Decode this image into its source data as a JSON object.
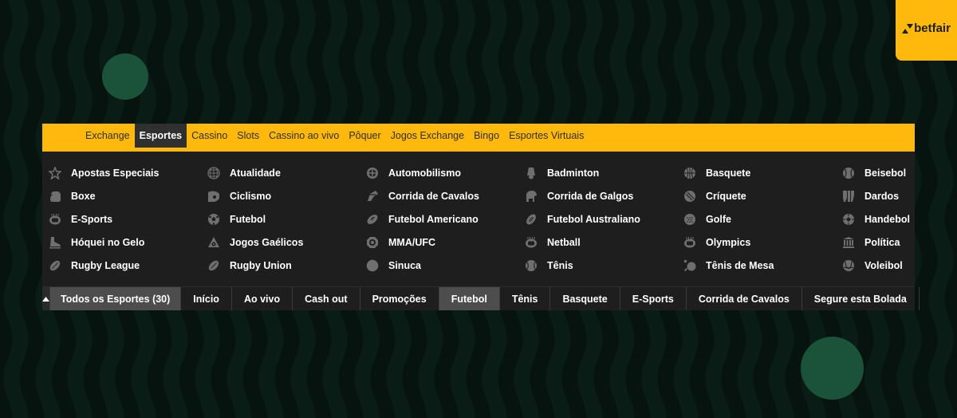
{
  "brand": {
    "name": "betfair",
    "accent_color": "#ffb80c"
  },
  "top_nav": {
    "items": [
      {
        "label": "Exchange",
        "active": false
      },
      {
        "label": "Esportes",
        "active": true
      },
      {
        "label": "Cassino",
        "active": false
      },
      {
        "label": "Slots",
        "active": false
      },
      {
        "label": "Cassino ao vivo",
        "active": false
      },
      {
        "label": "Pôquer",
        "active": false
      },
      {
        "label": "Jogos Exchange",
        "active": false
      },
      {
        "label": "Bingo",
        "active": false
      },
      {
        "label": "Esportes Virtuais",
        "active": false
      }
    ]
  },
  "sports": [
    {
      "label": "Apostas Especiais",
      "icon": "star-icon"
    },
    {
      "label": "Atualidade",
      "icon": "globe-icon"
    },
    {
      "label": "Automobilismo",
      "icon": "steering-wheel-icon"
    },
    {
      "label": "Badminton",
      "icon": "shuttlecock-icon"
    },
    {
      "label": "Basquete",
      "icon": "basketball-icon"
    },
    {
      "label": "Beisebol",
      "icon": "baseball-icon"
    },
    {
      "label": "Boxe",
      "icon": "boxing-glove-icon"
    },
    {
      "label": "Ciclismo",
      "icon": "cycling-helmet-icon"
    },
    {
      "label": "Corrida de Cavalos",
      "icon": "horse-racing-icon"
    },
    {
      "label": "Corrida de Galgos",
      "icon": "greyhound-icon"
    },
    {
      "label": "Críquete",
      "icon": "cricket-ball-icon"
    },
    {
      "label": "Dardos",
      "icon": "darts-icon"
    },
    {
      "label": "E-Sports",
      "icon": "stadium-icon"
    },
    {
      "label": "Futebol",
      "icon": "soccer-ball-icon"
    },
    {
      "label": "Futebol Americano",
      "icon": "american-football-icon"
    },
    {
      "label": "Futebol Australiano",
      "icon": "aussie-football-icon"
    },
    {
      "label": "Golfe",
      "icon": "golf-ball-icon"
    },
    {
      "label": "Handebol",
      "icon": "handball-icon"
    },
    {
      "label": "Hóquei no Gelo",
      "icon": "ice-skate-icon"
    },
    {
      "label": "Jogos Gaélicos",
      "icon": "gaelic-icon"
    },
    {
      "label": "MMA/UFC",
      "icon": "octagon-icon"
    },
    {
      "label": "Netball",
      "icon": "stadium-icon"
    },
    {
      "label": "Olympics",
      "icon": "stadium-icon"
    },
    {
      "label": "Política",
      "icon": "government-building-icon"
    },
    {
      "label": "Rugby League",
      "icon": "rugby-ball-icon"
    },
    {
      "label": "Rugby Union",
      "icon": "rugby-ball-icon"
    },
    {
      "label": "Sinuca",
      "icon": "snooker-ball-icon"
    },
    {
      "label": "Tênis",
      "icon": "tennis-ball-icon"
    },
    {
      "label": "Tênis de Mesa",
      "icon": "table-tennis-icon"
    },
    {
      "label": "Voleibol",
      "icon": "volleyball-icon"
    }
  ],
  "bottom_nav": {
    "toggle_icon": "chevron-up-icon",
    "items": [
      {
        "label": "Todos os Esportes (30)",
        "active": true
      },
      {
        "label": "Início",
        "active": false
      },
      {
        "label": "Ao vivo",
        "active": false
      },
      {
        "label": "Cash out",
        "active": false
      },
      {
        "label": "Promoções",
        "active": false
      },
      {
        "label": "Futebol",
        "active": true
      },
      {
        "label": "Tênis",
        "active": false
      },
      {
        "label": "Basquete",
        "active": false
      },
      {
        "label": "E-Sports",
        "active": false
      },
      {
        "label": "Corrida de Cavalos",
        "active": false
      },
      {
        "label": "Segure esta Bolada",
        "active": false
      }
    ]
  }
}
